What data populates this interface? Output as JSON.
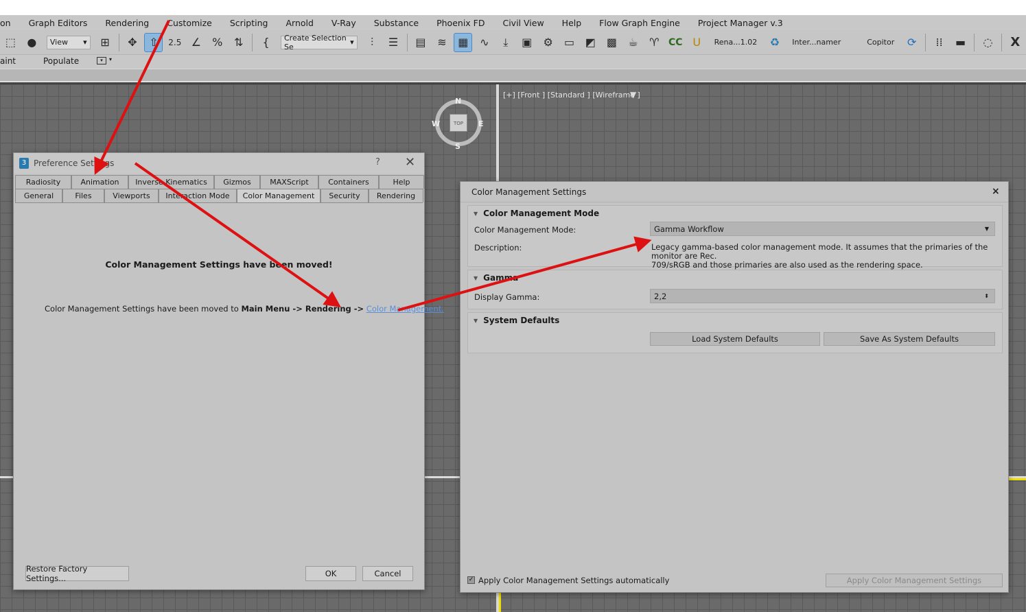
{
  "menubar": {
    "items": [
      "on",
      "Graph Editors",
      "Rendering",
      "Customize",
      "Scripting",
      "Arnold",
      "V-Ray",
      "Substance",
      "Phoenix FD",
      "Civil View",
      "Help",
      "Flow Graph Engine",
      "Project Manager v.3"
    ]
  },
  "toolbar": {
    "view_combo": "View",
    "selection_combo": "Create Selection Se",
    "label_rena": "Rena...1.02",
    "label_inter": "Inter...namer",
    "label_copitor": "Copitor",
    "snap_label": "2.5",
    "close_glyph": "X"
  },
  "bar2": {
    "paint": "aint",
    "populate": "Populate"
  },
  "viewport": {
    "label": "[+] [Front ] [Standard ] [Wireframe ]",
    "cube_top": "TOP",
    "north": "N",
    "south": "S",
    "east": "E",
    "west": "W"
  },
  "pref_dialog": {
    "title": "Preference Settings",
    "help": "?",
    "close": "✕",
    "tabs_row1": [
      "Radiosity",
      "Animation",
      "Inverse Kinematics",
      "Gizmos",
      "MAXScript",
      "Containers",
      "Help"
    ],
    "tabs_row2": [
      "General",
      "Files",
      "Viewports",
      "Interaction Mode",
      "Color Management",
      "Security",
      "Rendering"
    ],
    "selected_tab": "Color Management",
    "heading": "Color Management Settings have been moved!",
    "body_prefix": "Color Management Settings have been moved to ",
    "body_path": "Main Menu -> Rendering ->",
    "body_link": "Color Management.",
    "restore_button": "Restore Factory Settings...",
    "ok_button": "OK",
    "cancel_button": "Cancel"
  },
  "cm_panel": {
    "title": "Color Management Settings",
    "close": "×",
    "mode_section": "Color Management Mode",
    "mode_label": "Color Management Mode:",
    "mode_value": "Gamma Workflow",
    "description_label": "Description:",
    "description_line1": "Legacy gamma-based color management mode. It assumes that the primaries of the monitor are Rec.",
    "description_line2": "709/sRGB and those primaries are also used as the rendering space.",
    "gamma_section": "Gamma",
    "display_gamma_label": "Display Gamma:",
    "display_gamma_value": "2,2",
    "defaults_section": "System Defaults",
    "load_defaults": "Load System Defaults",
    "save_defaults": "Save As System Defaults",
    "auto_apply_label": "Apply Color Management Settings automatically",
    "auto_apply_checked": true,
    "apply_button": "Apply Color Management Settings"
  },
  "colors": {
    "annotation_arrow": "#dd1111",
    "link": "#5a8fd8",
    "viewport_bg": "#6a6a6a"
  }
}
